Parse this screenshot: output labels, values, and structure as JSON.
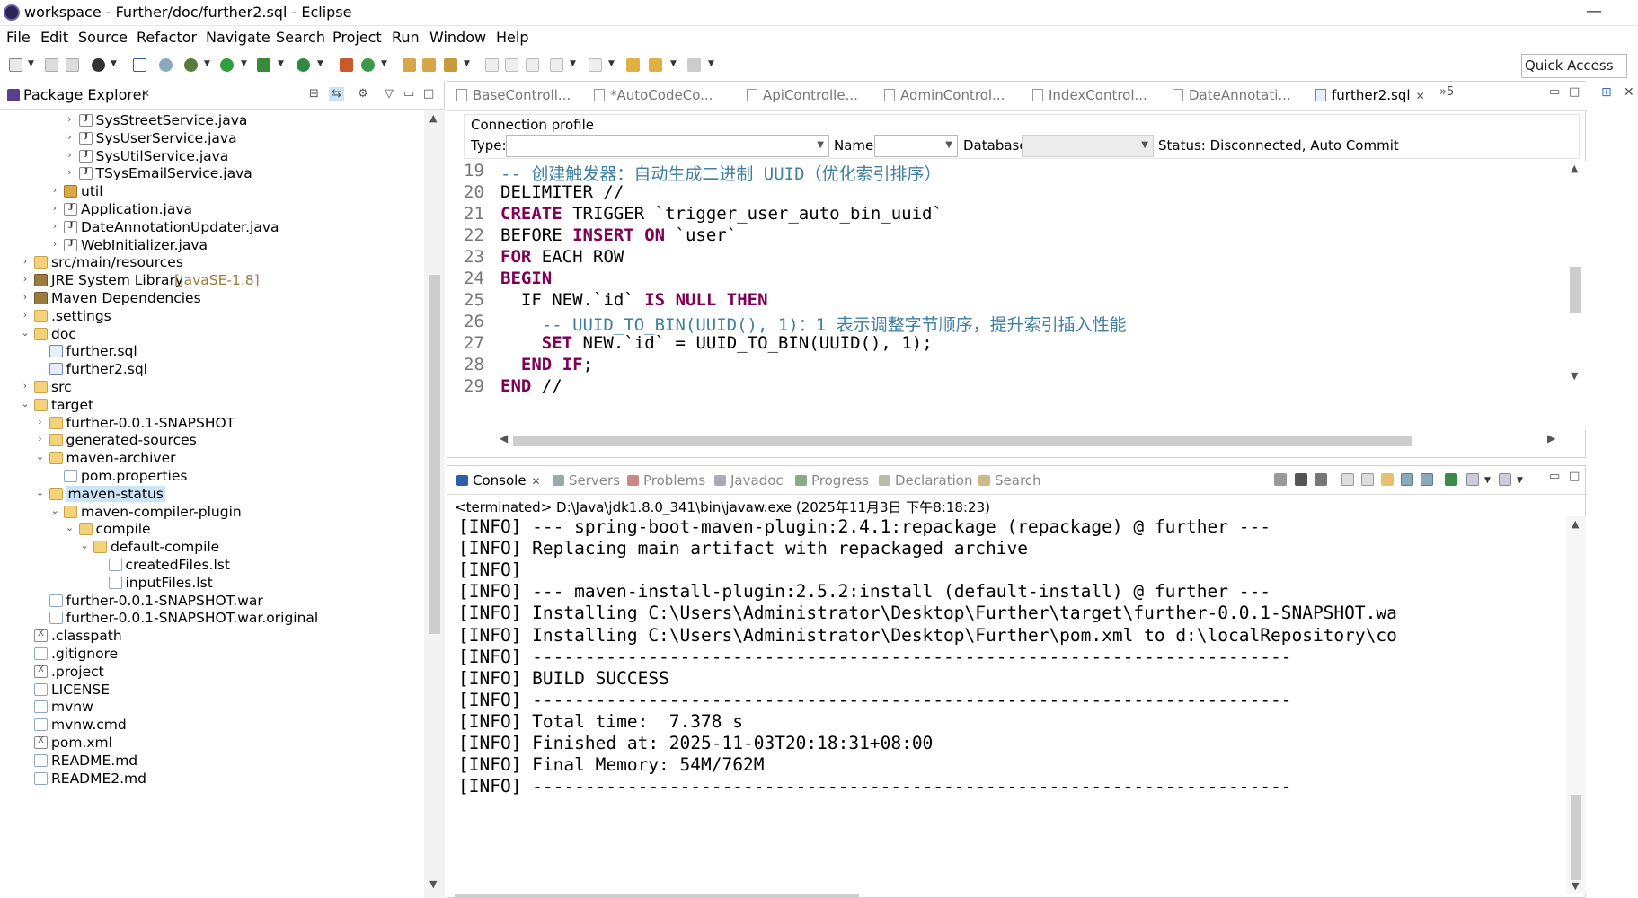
{
  "window": {
    "title": "workspace - Further/doc/further2.sql - Eclipse"
  },
  "menu": [
    "File",
    "Edit",
    "Source",
    "Refactor",
    "Navigate",
    "Search",
    "Project",
    "Run",
    "Window",
    "Help"
  ],
  "toolbar": {
    "quick_access": "Quick Access"
  },
  "package_explorer": {
    "title": "Package Explorer",
    "items": [
      {
        "label": "SysStreetService.java",
        "type": "java",
        "depth": 4,
        "twisty": "closed"
      },
      {
        "label": "SysUserService.java",
        "type": "java",
        "depth": 4,
        "twisty": "closed"
      },
      {
        "label": "SysUtilService.java",
        "type": "java",
        "depth": 4,
        "twisty": "closed"
      },
      {
        "label": "TSysEmailService.java",
        "type": "java",
        "depth": 4,
        "twisty": "closed"
      },
      {
        "label": "util",
        "type": "pkg",
        "depth": 3,
        "twisty": "closed"
      },
      {
        "label": "Application.java",
        "type": "java",
        "depth": 3,
        "twisty": "closed"
      },
      {
        "label": "DateAnnotationUpdater.java",
        "type": "java",
        "depth": 3,
        "twisty": "closed"
      },
      {
        "label": "WebInitializer.java",
        "type": "java",
        "depth": 3,
        "twisty": "closed"
      },
      {
        "label": "src/main/resources",
        "type": "folder",
        "depth": 1,
        "twisty": "closed"
      },
      {
        "label": "JRE System Library",
        "suffix": "[JavaSE-1.8]",
        "type": "lib",
        "depth": 1,
        "twisty": "closed"
      },
      {
        "label": "Maven Dependencies",
        "type": "lib",
        "depth": 1,
        "twisty": "closed"
      },
      {
        "label": ".settings",
        "type": "folder",
        "depth": 1,
        "twisty": "closed"
      },
      {
        "label": "doc",
        "type": "folder",
        "depth": 1,
        "twisty": "open"
      },
      {
        "label": "further.sql",
        "type": "sql",
        "depth": 2,
        "twisty": ""
      },
      {
        "label": "further2.sql",
        "type": "sql",
        "depth": 2,
        "twisty": ""
      },
      {
        "label": "src",
        "type": "folder",
        "depth": 1,
        "twisty": "closed"
      },
      {
        "label": "target",
        "type": "folder",
        "depth": 1,
        "twisty": "open"
      },
      {
        "label": "further-0.0.1-SNAPSHOT",
        "type": "folder",
        "depth": 2,
        "twisty": "closed"
      },
      {
        "label": "generated-sources",
        "type": "folder",
        "depth": 2,
        "twisty": "closed"
      },
      {
        "label": "maven-archiver",
        "type": "folder",
        "depth": 2,
        "twisty": "open"
      },
      {
        "label": "pom.properties",
        "type": "file",
        "depth": 3,
        "twisty": ""
      },
      {
        "label": "maven-status",
        "type": "folder",
        "depth": 2,
        "twisty": "open",
        "selected": true
      },
      {
        "label": "maven-compiler-plugin",
        "type": "folder",
        "depth": 3,
        "twisty": "open"
      },
      {
        "label": "compile",
        "type": "folder",
        "depth": 4,
        "twisty": "open"
      },
      {
        "label": "default-compile",
        "type": "folder",
        "depth": 5,
        "twisty": "open"
      },
      {
        "label": "createdFiles.lst",
        "type": "file",
        "depth": 6,
        "twisty": ""
      },
      {
        "label": "inputFiles.lst",
        "type": "file",
        "depth": 6,
        "twisty": ""
      },
      {
        "label": "further-0.0.1-SNAPSHOT.war",
        "type": "file",
        "depth": 2,
        "twisty": ""
      },
      {
        "label": "further-0.0.1-SNAPSHOT.war.original",
        "type": "file",
        "depth": 2,
        "twisty": ""
      },
      {
        "label": ".classpath",
        "type": "xfile",
        "depth": 1,
        "twisty": ""
      },
      {
        "label": ".gitignore",
        "type": "file",
        "depth": 1,
        "twisty": ""
      },
      {
        "label": ".project",
        "type": "xfile",
        "depth": 1,
        "twisty": ""
      },
      {
        "label": "LICENSE",
        "type": "file",
        "depth": 1,
        "twisty": ""
      },
      {
        "label": "mvnw",
        "type": "file",
        "depth": 1,
        "twisty": ""
      },
      {
        "label": "mvnw.cmd",
        "type": "file",
        "depth": 1,
        "twisty": ""
      },
      {
        "label": "pom.xml",
        "type": "xfile",
        "depth": 1,
        "twisty": ""
      },
      {
        "label": "README.md",
        "type": "file",
        "depth": 1,
        "twisty": ""
      },
      {
        "label": "README2.md",
        "type": "file",
        "depth": 1,
        "twisty": ""
      }
    ]
  },
  "editor": {
    "tabs": [
      {
        "label": "BaseControll...",
        "active": false
      },
      {
        "label": "*AutoCodeCo...",
        "active": false
      },
      {
        "label": "ApiControlle...",
        "active": false
      },
      {
        "label": "AdminControl...",
        "active": false
      },
      {
        "label": "IndexControl...",
        "active": false
      },
      {
        "label": "DateAnnotati...",
        "active": false
      },
      {
        "label": "further2.sql",
        "active": true
      }
    ],
    "overflow_count": "»5",
    "connection_profile": {
      "legend": "Connection profile",
      "type_label": "Type:",
      "name_label": "Name:",
      "database_label": "Database:",
      "status": "Status: Disconnected, Auto Commit"
    },
    "code_lines": [
      {
        "num": "19",
        "text": "-- 创建触发器：自动生成二进制 UUID（优化索引排序）",
        "cls": "cmt"
      },
      {
        "num": "20",
        "text": "DELIMITER //",
        "cls": ""
      },
      {
        "num": "21",
        "text": "CREATE TRIGGER `trigger_user_auto_bin_uuid`",
        "cls": "mix1"
      },
      {
        "num": "22",
        "text": "BEFORE INSERT ON `user`",
        "cls": "mix2"
      },
      {
        "num": "23",
        "text": "FOR EACH ROW",
        "cls": "mix3"
      },
      {
        "num": "24",
        "text": "BEGIN",
        "cls": "kw"
      },
      {
        "num": "25",
        "text": "  IF NEW.`id` IS NULL THEN",
        "cls": "mix4"
      },
      {
        "num": "26",
        "text": "    -- UUID_TO_BIN(UUID(), 1)：1 表示调整字节顺序，提升索引插入性能",
        "cls": "cmt"
      },
      {
        "num": "27",
        "text": "    SET NEW.`id` = UUID_TO_BIN(UUID(), 1);",
        "cls": "mix5"
      },
      {
        "num": "28",
        "text": "  END IF;",
        "cls": "mix6"
      },
      {
        "num": "29",
        "text": "END //",
        "cls": "mix7"
      }
    ]
  },
  "console": {
    "tabs": [
      {
        "label": "Console",
        "active": true
      },
      {
        "label": "Servers",
        "active": false
      },
      {
        "label": "Problems",
        "active": false
      },
      {
        "label": "Javadoc",
        "active": false
      },
      {
        "label": "Progress",
        "active": false
      },
      {
        "label": "Declaration",
        "active": false
      },
      {
        "label": "Search",
        "active": false
      }
    ],
    "terminated": "<terminated> D:\\Java\\jdk1.8.0_341\\bin\\javaw.exe (2025年11月3日 下午8:18:23)",
    "lines": [
      "[INFO] --- spring-boot-maven-plugin:2.4.1:repackage (repackage) @ further ---",
      "[INFO] Replacing main artifact with repackaged archive",
      "[INFO]",
      "[INFO] --- maven-install-plugin:2.5.2:install (default-install) @ further ---",
      "[INFO] Installing C:\\Users\\Administrator\\Desktop\\Further\\target\\further-0.0.1-SNAPSHOT.wa",
      "[INFO] Installing C:\\Users\\Administrator\\Desktop\\Further\\pom.xml to d:\\localRepository\\co",
      "[INFO] ------------------------------------------------------------------------",
      "[INFO] BUILD SUCCESS",
      "[INFO] ------------------------------------------------------------------------",
      "[INFO] Total time:  7.378 s",
      "[INFO] Finished at: 2025-11-03T20:18:31+08:00",
      "[INFO] Final Memory: 54M/762M",
      "[INFO] ------------------------------------------------------------------------"
    ]
  },
  "colors": {
    "keyword": "#7f0055",
    "comment": "#3f7f9f",
    "selection": "#cce4f7"
  }
}
